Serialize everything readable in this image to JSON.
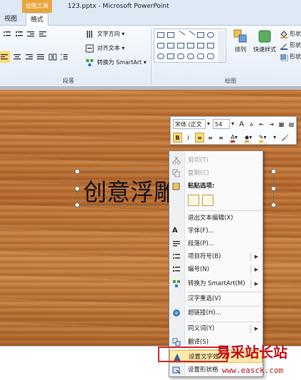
{
  "titlebar": {
    "context_tab": "绘图工具",
    "document_title": "123.pptx - Microsoft PowerPoint"
  },
  "tabs": [
    {
      "label": "视图",
      "active": false
    },
    {
      "label": "格式",
      "active": true
    }
  ],
  "ribbon": {
    "paragraph": {
      "text_direction": "文字方向",
      "align_text": "对齐文本",
      "convert_smartart": "转换为 SmartArt",
      "group_label": "段落"
    },
    "drawing": {
      "arrange": "排列",
      "quick_styles": "快速样式",
      "shape_fill": "形状",
      "shape_outline": "形状",
      "shape_effects": "形状",
      "group_label": "绘图"
    }
  },
  "slide": {
    "title_text": "创意浮雕"
  },
  "mini_toolbar": {
    "font_name": "宋体 (正文",
    "font_size": "54",
    "grow_font": "A",
    "shrink_font": "A",
    "bold": "B",
    "italic": "I"
  },
  "context_menu": {
    "items": [
      {
        "label": "剪切(T)",
        "icon": "scissors-icon",
        "enabled": false
      },
      {
        "label": "复制(C)",
        "icon": "copy-icon",
        "enabled": false
      },
      {
        "label": "粘贴选项:",
        "icon": "clipboard-icon",
        "enabled": true,
        "bold": true
      },
      {
        "label": "退出文本编辑(X)",
        "icon": "",
        "enabled": true
      },
      {
        "label": "字体(F)...",
        "icon": "font-icon",
        "enabled": true
      },
      {
        "label": "段落(P)...",
        "icon": "paragraph-icon",
        "enabled": true
      },
      {
        "label": "项目符号(B)",
        "icon": "bullets-icon",
        "enabled": true,
        "submenu": true
      },
      {
        "label": "编号(N)",
        "icon": "numbering-icon",
        "enabled": true,
        "submenu": true
      },
      {
        "label": "转换为 SmartArt(M)",
        "icon": "smartart-icon",
        "enabled": true,
        "submenu": true
      },
      {
        "label": "汉字重选(V)",
        "icon": "",
        "enabled": true
      },
      {
        "label": "超链接(H)...",
        "icon": "hyperlink-icon",
        "enabled": true
      },
      {
        "label": "同义词(Y)",
        "icon": "",
        "enabled": true,
        "submenu": true
      },
      {
        "label": "翻译(S)",
        "icon": "translate-icon",
        "enabled": true
      },
      {
        "label": "设置文字效",
        "icon": "text-effects-icon",
        "enabled": true,
        "highlighted": true
      },
      {
        "label": "设置形状格",
        "icon": "shape-format-icon",
        "enabled": true
      }
    ]
  },
  "watermark": {
    "chinese": "易采站长站",
    "url": "www.easck.com"
  },
  "colors": {
    "accent_orange": "#e8a73c",
    "highlight_red": "#d62a2a",
    "watermark_red": "#c0161c"
  }
}
